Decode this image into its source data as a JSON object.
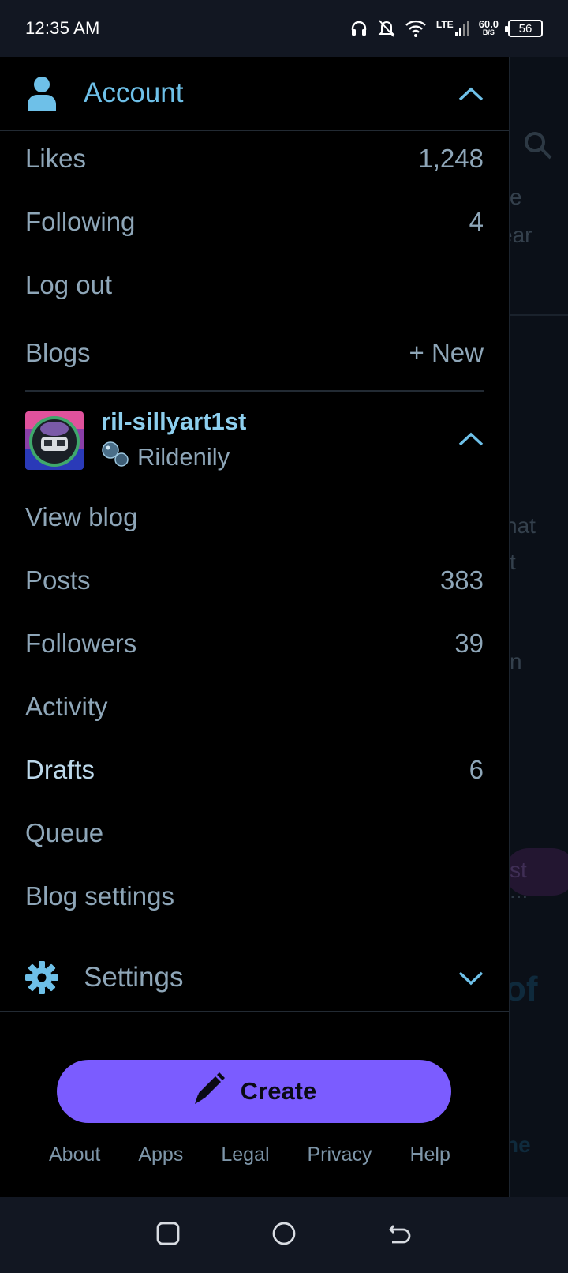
{
  "status": {
    "time": "12:35 AM",
    "net_speed_value": "60.0",
    "net_speed_unit": "B/S",
    "network": "LTE",
    "battery": "56"
  },
  "account": {
    "title": "Account",
    "items": [
      {
        "label": "Likes",
        "value": "1,248"
      },
      {
        "label": "Following",
        "value": "4"
      },
      {
        "label": "Log out",
        "value": ""
      }
    ]
  },
  "blogs": {
    "label": "Blogs",
    "new_label": "+ New",
    "blog": {
      "name": "ril-sillyart1st",
      "title": "Rildenily"
    },
    "items": [
      {
        "label": "View blog",
        "value": ""
      },
      {
        "label": "Posts",
        "value": "383"
      },
      {
        "label": "Followers",
        "value": "39"
      },
      {
        "label": "Activity",
        "value": ""
      },
      {
        "label": "Drafts",
        "value": "6"
      },
      {
        "label": "Queue",
        "value": ""
      },
      {
        "label": "Blog settings",
        "value": ""
      }
    ]
  },
  "settings": {
    "title": "Settings"
  },
  "create": {
    "label": "Create"
  },
  "footer": {
    "links": [
      "About",
      "Apps",
      "Legal",
      "Privacy",
      "Help"
    ]
  },
  "background": {
    "fragments": [
      "e",
      "ear",
      "hat",
      "t",
      "n",
      "st",
      "...",
      "of",
      "he"
    ]
  },
  "colors": {
    "accent": "#7b5cff",
    "link_blue": "#6ec0e8",
    "text_muted": "#8ea6b8"
  }
}
